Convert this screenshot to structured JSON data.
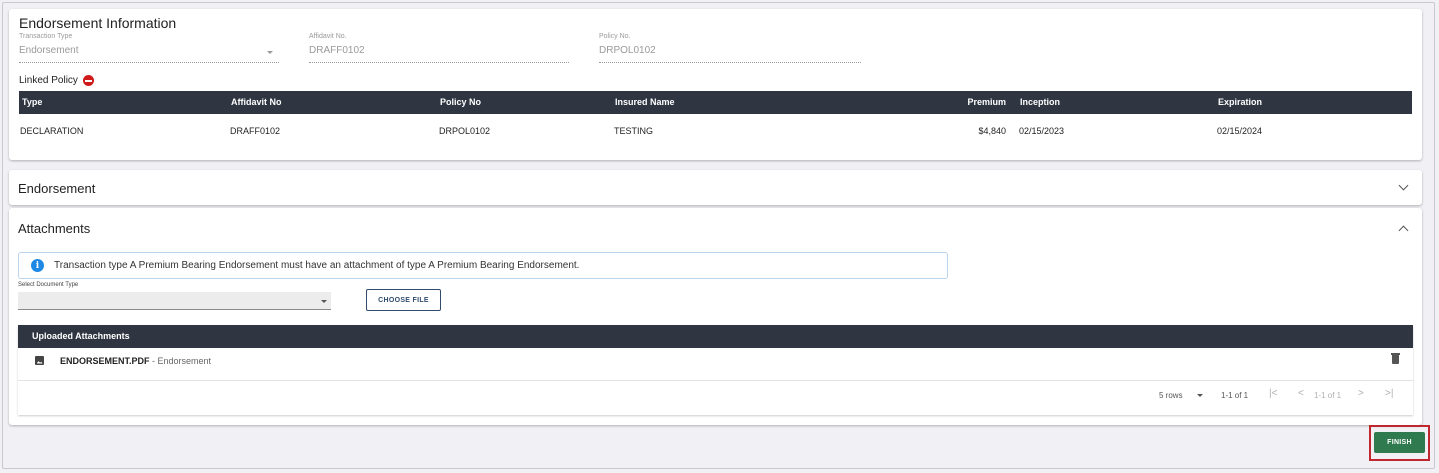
{
  "info": {
    "title": "Endorsement Information",
    "transaction_type": {
      "label": "Transaction Type",
      "value": "Endorsement"
    },
    "affidavit_no": {
      "label": "Affidavit No.",
      "value": "DRAFF0102"
    },
    "policy_no": {
      "label": "Policy No.",
      "value": "DRPOL0102"
    },
    "linked_policy_label": "Linked Policy",
    "table": {
      "headers": [
        "Type",
        "Affidavit No",
        "Policy No",
        "Insured Name",
        "Premium",
        "Inception",
        "Expiration"
      ],
      "rows": [
        [
          "DECLARATION",
          "DRAFF0102",
          "DRPOL0102",
          "TESTING",
          "$4,840",
          "02/15/2023",
          "02/15/2024"
        ]
      ]
    }
  },
  "endorsement": {
    "title": "Endorsement",
    "expanded": false
  },
  "attachments": {
    "title": "Attachments",
    "expanded": true,
    "banner_text": "Transaction type A Premium Bearing Endorsement must have an attachment of type A Premium Bearing Endorsement.",
    "select_label": "Select Document Type",
    "select_value": "",
    "choose_file_label": "CHOOSE FILE",
    "uploaded_header": "Uploaded Attachments",
    "files": [
      {
        "name": "ENDORSEMENT.PDF",
        "separator": " - ",
        "type": "Endorsement"
      }
    ],
    "pagination": {
      "rows_per_page": "5 rows",
      "range_label": "1-1 of 1",
      "page_label": "1-1 of 1"
    }
  },
  "finish_label": "FINISH",
  "colors": {
    "header_bg": "#2f3541",
    "finish_bg": "#2f7a4e",
    "highlight": "#c0262d",
    "info": "#1e88e5",
    "remove": "#d01919"
  }
}
